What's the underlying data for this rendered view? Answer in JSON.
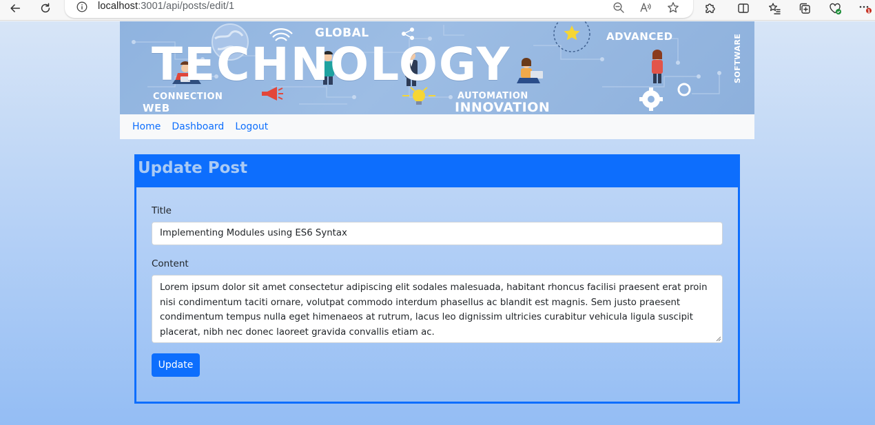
{
  "browser": {
    "url_host": "localhost",
    "url_path": ":3001/api/posts/edit/1",
    "notification_badge": "1"
  },
  "banner": {
    "main_word": "TECHNOLOGY",
    "words": {
      "global": "GLOBAL",
      "advanced": "ADVANCED",
      "connection": "CONNECTION",
      "web": "WEB",
      "automation": "AUTOMATION",
      "innovation": "INNOVATION",
      "software": "SOFTWARE"
    }
  },
  "nav": {
    "links": [
      "Home",
      "Dashboard",
      "Logout"
    ]
  },
  "card": {
    "title": "Update Post"
  },
  "form": {
    "title_label": "Title",
    "title_value": "Implementing Modules using ES6 Syntax",
    "content_label": "Content",
    "content_value": "Lorem ipsum dolor sit amet consectetur adipiscing elit sodales malesuada, habitant rhoncus facilisi praesent erat proin nisi condimentum taciti ornare, volutpat commodo interdum phasellus ac blandit est magnis. Sem justo praesent condimentum tempus nulla eget himenaeos at rutrum, lacus leo dignissim ultricies curabitur vehicula ligula suscipit placerat, nibh nec donec laoreet gravida convallis etiam ac.",
    "submit_label": "Update"
  },
  "colors": {
    "primary": "#0d6efd",
    "card_title_text": "#a9caf4",
    "page_gradient_top": "#d7e5f7",
    "page_gradient_bottom": "#94bdf4"
  }
}
